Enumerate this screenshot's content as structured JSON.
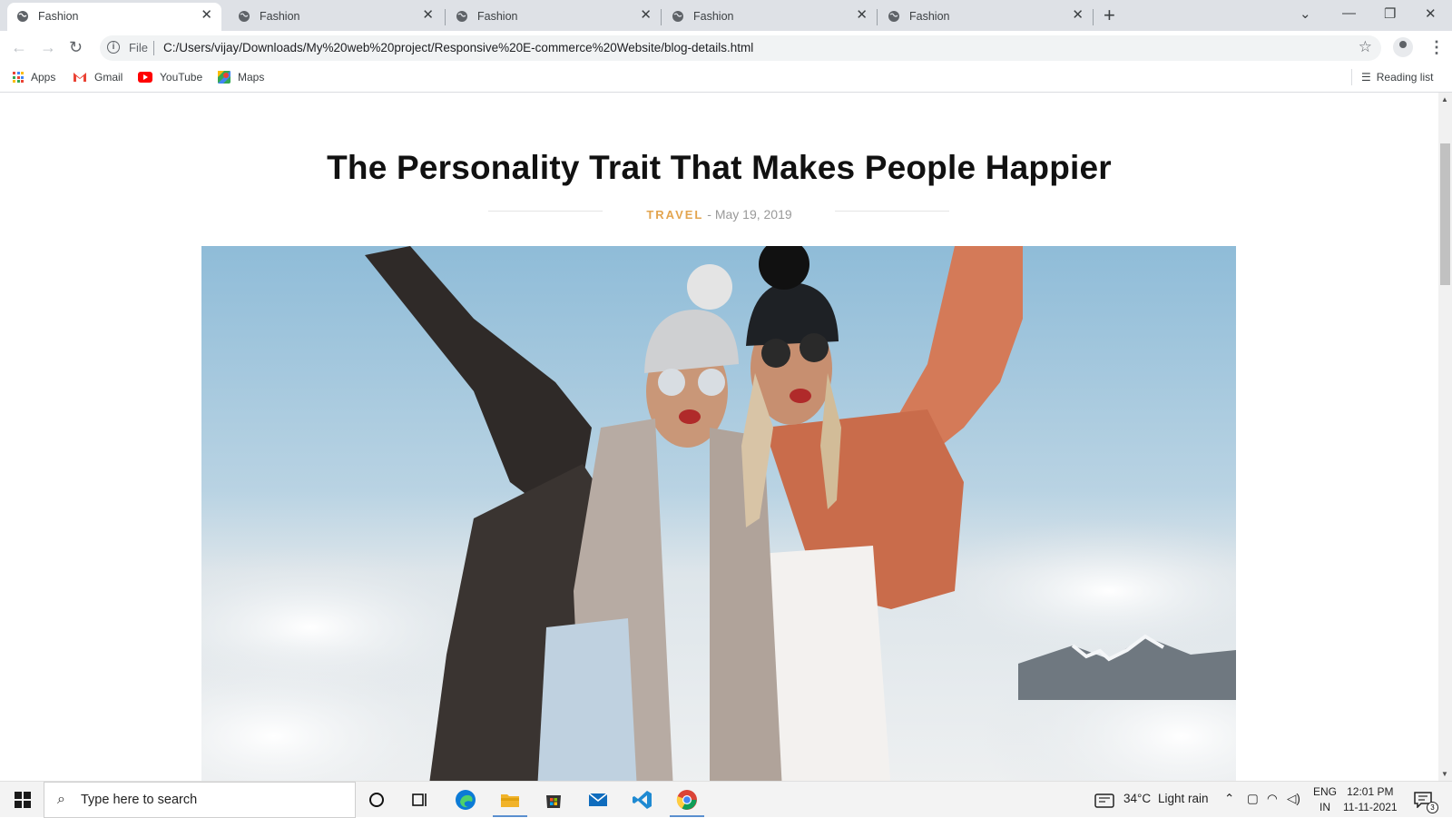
{
  "browser": {
    "tabs": [
      {
        "title": "Fashion",
        "active": true
      },
      {
        "title": "Fashion",
        "active": false
      },
      {
        "title": "Fashion",
        "active": false
      },
      {
        "title": "Fashion",
        "active": false
      },
      {
        "title": "Fashion",
        "active": false
      }
    ],
    "address_scheme": "File",
    "address_url": "C:/Users/vijay/Downloads/My%20web%20project/Responsive%20E-commerce%20Website/blog-details.html",
    "bookmarks": [
      {
        "label": "Apps",
        "icon": "apps-grid-icon"
      },
      {
        "label": "Gmail",
        "icon": "gmail-icon"
      },
      {
        "label": "YouTube",
        "icon": "youtube-icon"
      },
      {
        "label": "Maps",
        "icon": "maps-icon"
      }
    ],
    "reading_list": "Reading list"
  },
  "page": {
    "title": "The Personality Trait That Makes People Happier",
    "category": "TRAVEL",
    "date": "- May 19, 2019",
    "hero_alt": "Two women in winter jackets and beanies cheering above the clouds"
  },
  "taskbar": {
    "search_placeholder": "Type here to search",
    "weather_temp": "34°C",
    "weather_text": "Light rain",
    "lang_top": "ENG",
    "lang_bottom": "IN",
    "time": "12:01 PM",
    "date": "11-11-2021",
    "notification_count": "3"
  },
  "colors": {
    "accent": "#e3a54f",
    "chrome_tabbar": "#dee1e6"
  }
}
